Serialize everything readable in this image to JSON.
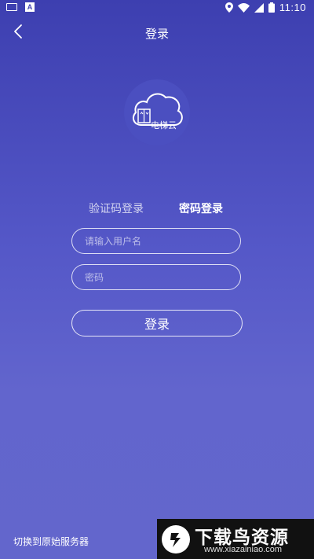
{
  "status_bar": {
    "time": "11:10",
    "left_icon_letter": "A"
  },
  "header": {
    "title": "登录"
  },
  "logo": {
    "text": "电梯云"
  },
  "tabs": [
    {
      "label": "验证码登录",
      "active": false
    },
    {
      "label": "密码登录",
      "active": true
    }
  ],
  "form": {
    "username_placeholder": "请输入用户名",
    "password_placeholder": "密码",
    "login_label": "登录"
  },
  "footer": {
    "switch_label": "切换到原始服务器"
  },
  "watermark": {
    "title": "下载鸟资源",
    "url": "www.xiazainiao.com"
  },
  "colors": {
    "bg_top": "#3d3fb0",
    "bg_bottom": "#6366cc",
    "logo_circle": "#4b4fc0"
  }
}
